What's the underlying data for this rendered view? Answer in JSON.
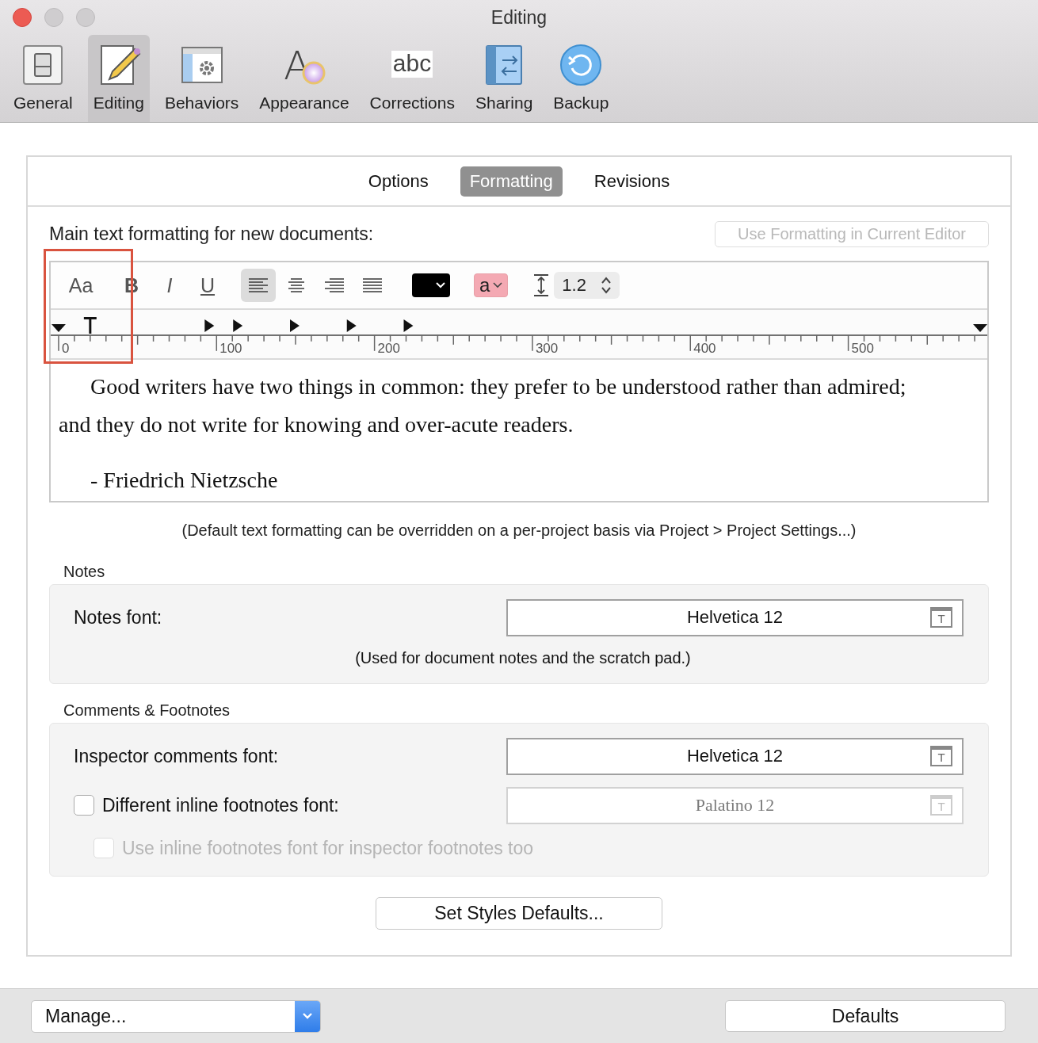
{
  "window": {
    "title": "Editing"
  },
  "toolbar": [
    {
      "label": "General",
      "selected": false
    },
    {
      "label": "Editing",
      "selected": true
    },
    {
      "label": "Behaviors",
      "selected": false
    },
    {
      "label": "Appearance",
      "icon_text": "A",
      "selected": false
    },
    {
      "label": "Corrections",
      "icon_text": "abc",
      "selected": false
    },
    {
      "label": "Sharing",
      "selected": false
    },
    {
      "label": "Backup",
      "selected": false
    }
  ],
  "segments": [
    {
      "label": "Options",
      "selected": false
    },
    {
      "label": "Formatting",
      "selected": true
    },
    {
      "label": "Revisions",
      "selected": false
    }
  ],
  "formatting": {
    "heading": "Main text formatting for new documents:",
    "use_button": {
      "label": "Use Formatting in Current Editor",
      "disabled": true
    },
    "font_button": "Aa",
    "bold": "B",
    "italic": "I",
    "underline": "U",
    "alignments": [
      {
        "kind": "left",
        "selected": true
      },
      {
        "kind": "center",
        "selected": false
      },
      {
        "kind": "right",
        "selected": false
      },
      {
        "kind": "justify",
        "selected": false
      }
    ],
    "highlight": {
      "label": "a",
      "color": "#f4a9b3"
    },
    "line_spacing": "1.2",
    "ruler_labels": [
      "0",
      "100",
      "200",
      "300",
      "400",
      "500"
    ],
    "preview": [
      "Good writers have two things in common: they prefer to be understood rather than admired; and they do not write for knowing and over-acute readers.",
      "- Friedrich Nietzsche"
    ],
    "note": "(Default text formatting can be overridden on a per-project basis via Project > Project Settings...)"
  },
  "groups": [
    {
      "title": "Notes",
      "rows": [
        {
          "kind": "font",
          "label": "Notes font:",
          "value": "Helvetica 12",
          "icon_text": "T"
        },
        {
          "kind": "caption",
          "label": "(Used for document notes and the scratch pad.)"
        }
      ]
    },
    {
      "title": "Comments & Footnotes",
      "rows": [
        {
          "kind": "font",
          "label": "Inspector comments font:",
          "value": "Helvetica 12",
          "icon_text": "T"
        },
        {
          "kind": "checkfont",
          "label": "Different inline footnotes font:",
          "checked": false,
          "value": "Palatino 12",
          "value_disabled": true,
          "icon_text": "T"
        },
        {
          "kind": "check",
          "label": "Use inline footnotes font for inspector footnotes too",
          "checked": false,
          "disabled": true
        }
      ]
    }
  ],
  "set_styles_button": "Set Styles Defaults...",
  "bottom": {
    "manage": "Manage...",
    "defaults": "Defaults"
  }
}
